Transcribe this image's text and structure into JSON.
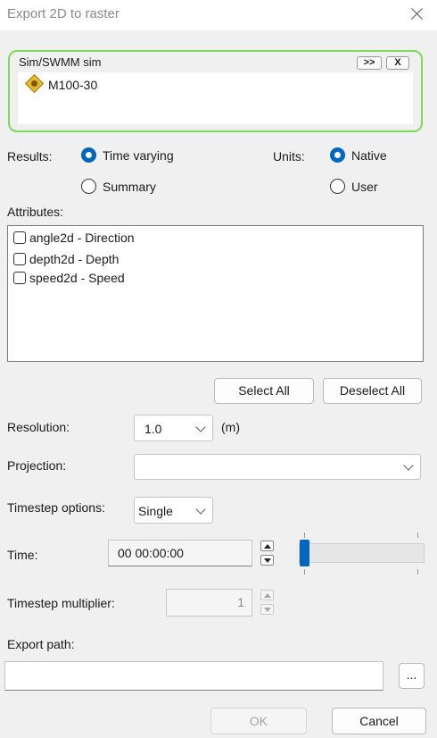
{
  "window": {
    "title": "Export 2D to raster"
  },
  "sim": {
    "label": "Sim/SWMM sim",
    "expand_button": ">>",
    "remove_button": "X",
    "items": [
      {
        "name": "M100-30",
        "icon": "sim-diamond-icon"
      }
    ]
  },
  "results": {
    "label": "Results:",
    "options": [
      {
        "label": "Time varying",
        "selected": true
      },
      {
        "label": "Summary",
        "selected": false
      }
    ]
  },
  "units": {
    "label": "Units:",
    "options": [
      {
        "label": "Native",
        "selected": true
      },
      {
        "label": "User",
        "selected": false
      }
    ]
  },
  "attributes": {
    "label": "Attributes:",
    "items": [
      {
        "label": "angle2d - Direction",
        "checked": false
      },
      {
        "label": "depth2d - Depth",
        "checked": false
      },
      {
        "label": "speed2d - Speed",
        "checked": false
      }
    ],
    "select_all": "Select All",
    "deselect_all": "Deselect All"
  },
  "resolution": {
    "label": "Resolution:",
    "value": "1.0",
    "unit": "(m)"
  },
  "projection": {
    "label": "Projection:",
    "value": ""
  },
  "timestep_options": {
    "label": "Timestep options:",
    "value": "Single"
  },
  "time": {
    "label": "Time:",
    "value": "00 00:00:00",
    "slider_fraction": 0.0
  },
  "timestep_multiplier": {
    "label": "Timestep multiplier:",
    "value": "1"
  },
  "export_path": {
    "label": "Export path:",
    "value": "",
    "browse_label": "..."
  },
  "footer": {
    "ok": "OK",
    "cancel": "Cancel"
  },
  "colors": {
    "accent": "#0067c0",
    "focus_border": "#7ed957",
    "icon": "#e6b830"
  }
}
